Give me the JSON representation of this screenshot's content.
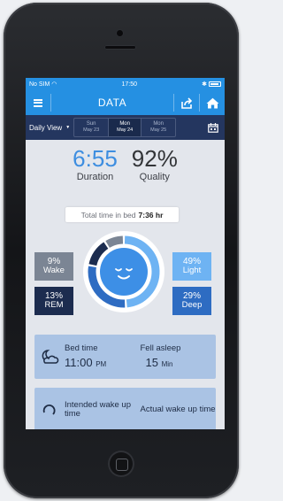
{
  "status": {
    "carrier": "No SIM",
    "time": "17:50"
  },
  "nav": {
    "title": "DATA"
  },
  "subnav": {
    "view_label": "Daily View",
    "dates": [
      {
        "dow": "Sun",
        "date": "May 23"
      },
      {
        "dow": "Mon",
        "date": "May 24"
      },
      {
        "dow": "Mon",
        "date": "May 25"
      }
    ]
  },
  "summary": {
    "duration_value": "6:55",
    "duration_label": "Duration",
    "quality_value": "92%",
    "quality_label": "Quality"
  },
  "total_bed": {
    "label": "Total time in bed",
    "value": "7:36 hr"
  },
  "stages": {
    "wake": {
      "pct": "9%",
      "label": "Wake",
      "fraction": 0.09
    },
    "rem": {
      "pct": "13%",
      "label": "REM",
      "fraction": 0.13
    },
    "light": {
      "pct": "49%",
      "label": "Light",
      "fraction": 0.49
    },
    "deep": {
      "pct": "29%",
      "label": "Deep",
      "fraction": 0.29
    }
  },
  "card_bed": {
    "bed_label": "Bed time",
    "bed_value": "11:00",
    "bed_unit": "PM",
    "asleep_label": "Fell asleep",
    "asleep_value": "15",
    "asleep_unit": "Min"
  },
  "card_wake": {
    "intended_label": "Intended wake up time",
    "actual_label": "Actual wake up time"
  },
  "colors": {
    "accent": "#2590e2",
    "navy": "#24365f",
    "wake": "#7b8594",
    "rem": "#1c2c4f",
    "light": "#6eb3f3",
    "deep": "#2e6cc2"
  }
}
